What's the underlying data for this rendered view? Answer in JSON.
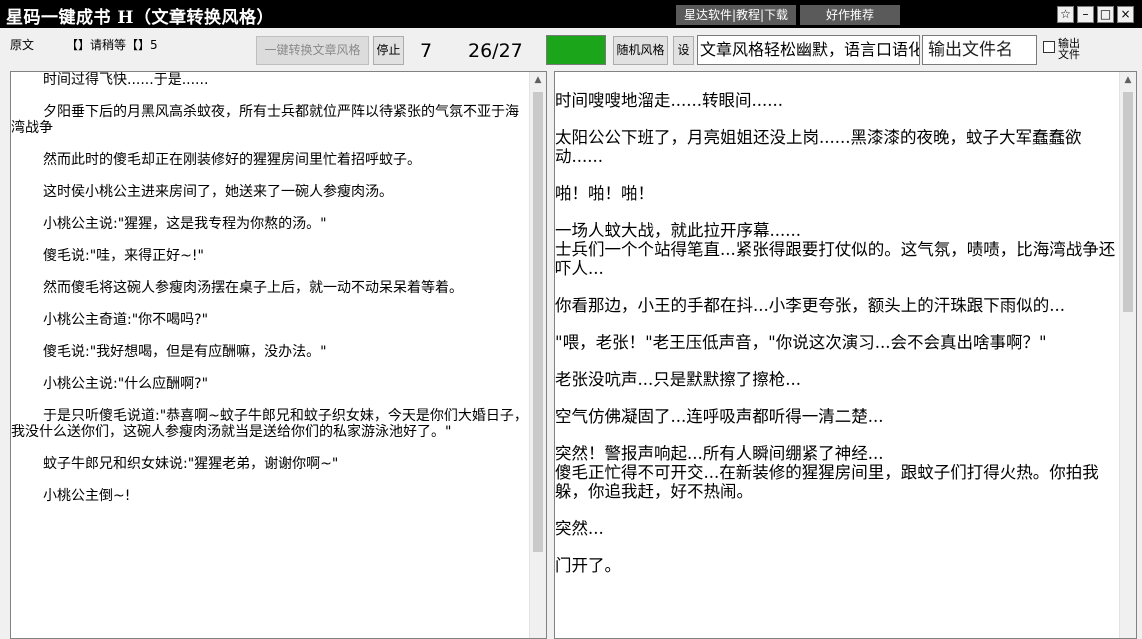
{
  "window": {
    "title": "星码一键成书 H（文章转换风格）",
    "links_label": "星达软件|教程|下载",
    "recommend_label": "好作推荐",
    "buttons": {
      "star": "☆",
      "min": "–",
      "max": "□",
      "close": "×"
    }
  },
  "toolbar": {
    "source_label": "原文",
    "status_text": "【】请稍等【】5",
    "convert_button": "一键转换文章风格",
    "stop_button": "停止",
    "count_current": "7",
    "progress": "26/27",
    "status_color": "#1aa51a",
    "random_style_button": "随机风格",
    "settings_button": "设",
    "style_input": "文章风格轻松幽默，语言口语化",
    "filename_placeholder": "输出文件名",
    "output_checkbox_label": "输出文件"
  },
  "original_text": [
    "时间过得飞快......于是......",
    "夕阳垂下后的月黑风高杀蚊夜，所有士兵都就位严阵以待紧张的气氛不亚于海湾战争",
    "然而此时的傻毛却正在刚装修好的猩猩房间里忙着招呼蚊子。",
    "这时侯小桃公主进来房间了，她送来了一碗人参瘦肉汤。",
    "小桃公主说:\"猩猩，这是我专程为你熬的汤。\"",
    "傻毛说:\"哇，来得正好~!\"",
    "然而傻毛将这碗人参瘦肉汤摆在桌子上后，就一动不动呆呆着等着。",
    "小桃公主奇道:\"你不喝吗?\"",
    "傻毛说:\"我好想喝，但是有应酬嘛，没办法。\"",
    "小桃公主说:\"什么应酬啊?\"",
    "于是只听傻毛说道:\"恭喜啊~蚊子牛郎兄和蚊子织女妹，今天是你们大婚日子，我没什么送你们，这碗人参瘦肉汤就当是送给你们的私家游泳池好了。\"",
    "蚊子牛郎兄和织女妹说:\"猩猩老弟，谢谢你啊~\"",
    "小桃公主倒~!"
  ],
  "converted_text": [
    "时间嗖嗖地溜走......转眼间......",
    "太阳公公下班了，月亮姐姐还没上岗......黑漆漆的夜晚，蚊子大军蠢蠢欲动......",
    "啪！啪！啪！",
    "一场人蚊大战，就此拉开序幕......\n士兵们一个个站得笔直...紧张得跟要打仗似的。这气氛，啧啧，比海湾战争还吓人...",
    "你看那边，小王的手都在抖...小李更夸张，额头上的汗珠跟下雨似的...",
    "\"喂，老张！\"老王压低声音，\"你说这次演习...会不会真出啥事啊？\"",
    "老张没吭声...只是默默擦了擦枪...",
    "空气仿佛凝固了...连呼吸声都听得一清二楚...",
    "突然！警报声响起...所有人瞬间绷紧了神经...\n傻毛正忙得不可开交...在新装修的猩猩房间里，跟蚊子们打得火热。你拍我躲，你追我赶，好不热闹。",
    "突然...",
    "门开了。"
  ]
}
